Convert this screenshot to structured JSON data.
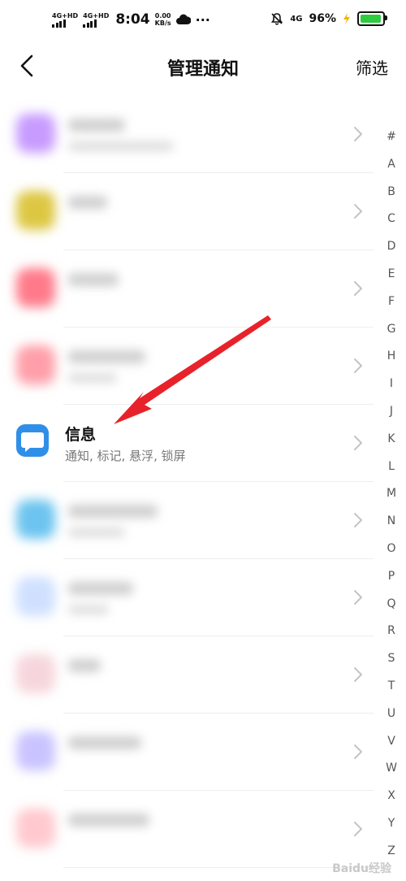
{
  "status_bar": {
    "net1": "4G+HD",
    "net2": "4G+HD",
    "time": "8:04",
    "speed_value": "0.00",
    "speed_unit": "KB/s",
    "more": "···",
    "net_right": "4G",
    "battery_text": "96%",
    "battery_level": 0.96
  },
  "header": {
    "title": "管理通知",
    "filter_label": "筛选"
  },
  "list": {
    "rows": [
      {
        "type": "blurred",
        "color": "#c79bff"
      },
      {
        "type": "blurred",
        "color": "#ddc742"
      },
      {
        "type": "blurred",
        "color": "#ff7a8a"
      },
      {
        "type": "blurred",
        "color": "#ff9fa9"
      },
      {
        "type": "app",
        "name": "信息",
        "subtitle": "通知, 标记, 悬浮, 锁屏"
      },
      {
        "type": "blurred",
        "color": "#6cc4ef"
      },
      {
        "type": "blurred",
        "color": "#cfe0ff"
      },
      {
        "type": "blurred",
        "color": "#f6d6dc"
      },
      {
        "type": "blurred",
        "color": "#c9c4ff"
      },
      {
        "type": "blurred",
        "color": "#ffc9cf"
      }
    ]
  },
  "alphabet": [
    "#",
    "A",
    "B",
    "C",
    "D",
    "E",
    "F",
    "G",
    "H",
    "I",
    "J",
    "K",
    "L",
    "M",
    "N",
    "O",
    "P",
    "Q",
    "R",
    "S",
    "T",
    "U",
    "V",
    "W",
    "X",
    "Y",
    "Z"
  ],
  "watermark": "Baidu经验",
  "colors": {
    "accent_arrow": "#e8222a",
    "app_icon": "#2f8fe8",
    "battery_fill": "#2ecc40"
  }
}
